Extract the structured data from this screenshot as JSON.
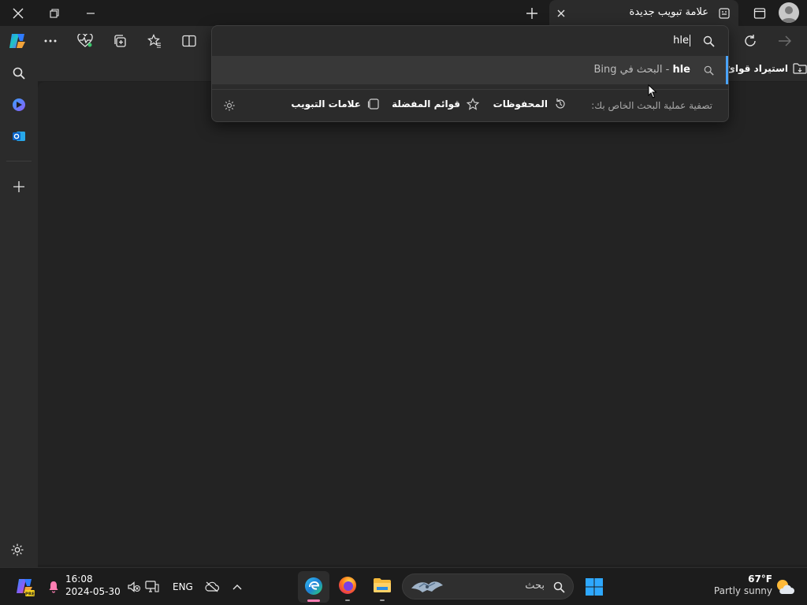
{
  "window": {
    "tab_title": "علامة تبويب جديدة"
  },
  "omnibox": {
    "query": "hle",
    "suggestion_query": "hle",
    "suggestion_suffix": " - البحث في Bing",
    "filter_prompt": "تصفية عملية البحث الخاص بك:",
    "filters": [
      {
        "label": "المحفوظات",
        "icon": "history-icon"
      },
      {
        "label": "قوائم المفضلة",
        "icon": "star-icon"
      },
      {
        "label": "علامات التبويب",
        "icon": "tabs-icon"
      }
    ]
  },
  "favorites_bar": {
    "import_label": "استيراد قوائ"
  },
  "taskbar": {
    "time": "16:08",
    "date": "2024-05-30",
    "language": "ENG",
    "search_placeholder": "بحث",
    "weather_temp": "67°F",
    "weather_desc": "Partly sunny"
  },
  "colors": {
    "accent": "#4aa4ff",
    "background": "#1f1f1f",
    "panel": "#2b2b2b"
  }
}
